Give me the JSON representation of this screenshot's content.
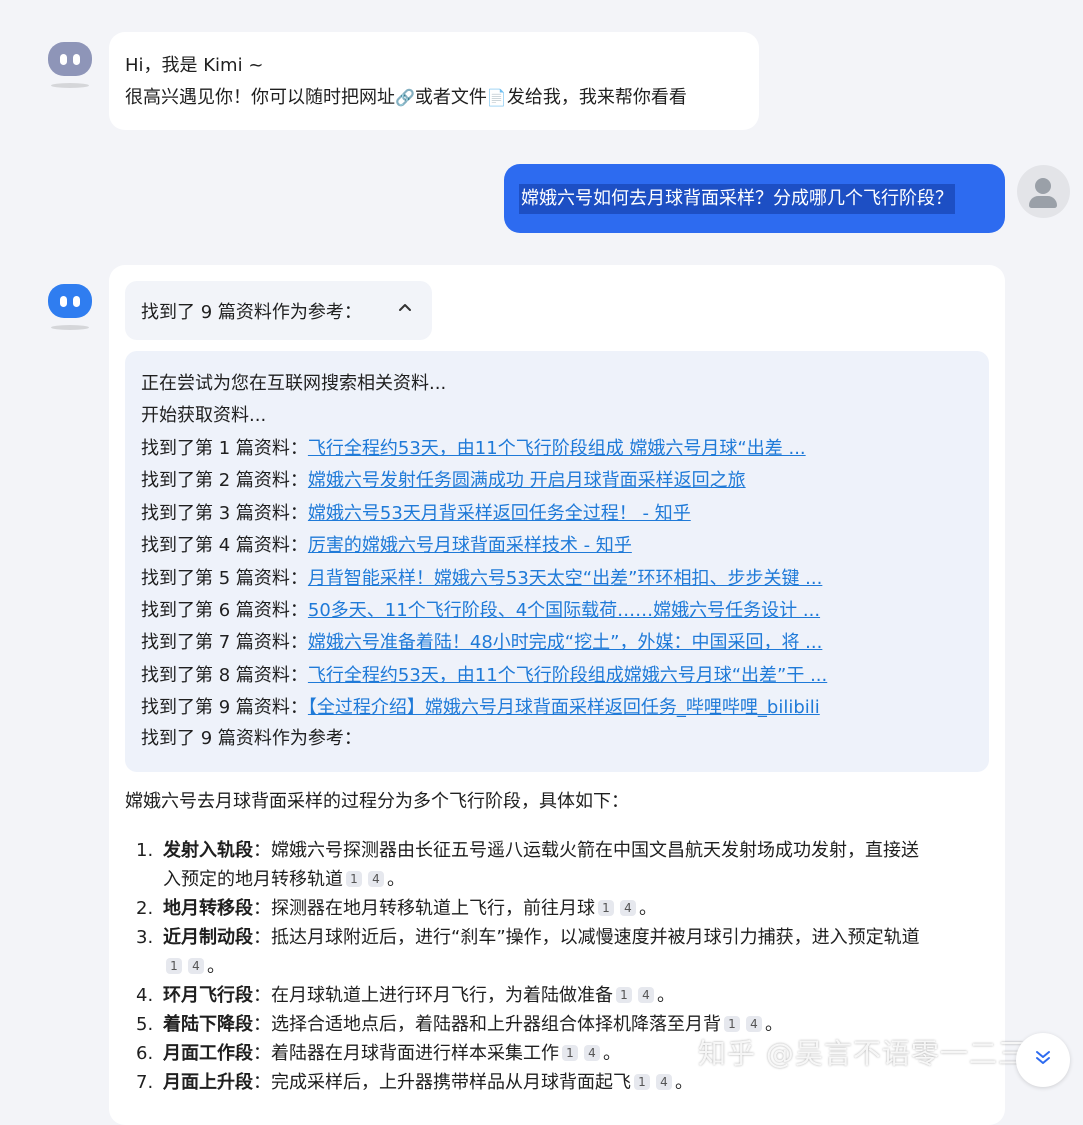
{
  "greeting": {
    "line1": "Hi，我是 Kimi ~",
    "line2_a": "很高兴遇见你！你可以随时把网址",
    "line2_link_icon": "🔗",
    "line2_b": "或者文件",
    "line2_file_icon": "📄",
    "line2_c": "发给我，我来帮你看看"
  },
  "user_message": "嫦娥六号如何去月球背面采样？分成哪几个飞行阶段？",
  "found_header": {
    "label": "找到了 9 篇资料作为参考：",
    "chevron": "⌃"
  },
  "search_log": {
    "trying": "正在尝试为您在互联网搜索相关资料...",
    "start": "开始获取资料...",
    "results": [
      {
        "prefix": "找到了第 1 篇资料：",
        "title": "飞行全程约53天，由11个飞行阶段组成 嫦娥六号月球“出差 ..."
      },
      {
        "prefix": "找到了第 2 篇资料：",
        "title": "嫦娥六号发射任务圆满成功 开启月球背面采样返回之旅"
      },
      {
        "prefix": "找到了第 3 篇资料：",
        "title": "嫦娥六号53天月背采样返回任务全过程！ - 知乎"
      },
      {
        "prefix": "找到了第 4 篇资料：",
        "title": "厉害的嫦娥六号月球背面采样技术 - 知乎"
      },
      {
        "prefix": "找到了第 5 篇资料：",
        "title": "月背智能采样！嫦娥六号53天太空“出差”环环相扣、步步关键 ..."
      },
      {
        "prefix": "找到了第 6 篇资料：",
        "title": "50多天、11个飞行阶段、4个国际载荷……嫦娥六号任务设计 ..."
      },
      {
        "prefix": "找到了第 7 篇资料：",
        "title": "嫦娥六号准备着陆！48小时完成“挖土”，外媒：中国采回，将 ..."
      },
      {
        "prefix": "找到了第 8 篇资料：",
        "title": "飞行全程约53天，由11个飞行阶段组成嫦娥六号月球“出差”干 ..."
      },
      {
        "prefix": "找到了第 9 篇资料：",
        "title": "【全过程介绍】嫦娥六号月球背面采样返回任务_哔哩哔哩_bilibili"
      }
    ],
    "footer": "找到了 9 篇资料作为参考："
  },
  "answer": {
    "intro": "嫦娥六号去月球背面采样的过程分为多个飞行阶段，具体如下：",
    "steps": [
      {
        "num": "1.",
        "name": "发射入轨段",
        "sep": "：",
        "text": "嫦娥六号探测器由长征五号遥八运载火箭在中国文昌航天发射场成功发射，直接送",
        "text2": "入预定的地月转移轨道",
        "cites": [
          "1",
          "4"
        ],
        "end": "。"
      },
      {
        "num": "2.",
        "name": "地月转移段",
        "sep": "：",
        "text": "探测器在地月转移轨道上飞行，前往月球",
        "cites": [
          "1",
          "4"
        ],
        "end": "。"
      },
      {
        "num": "3.",
        "name": "近月制动段",
        "sep": "：",
        "text": "抵达月球附近后，进行“刹车”操作，以减慢速度并被月球引力捕获，进入预定轨道",
        "cites": [
          "1",
          "4"
        ],
        "end": "。"
      },
      {
        "num": "4.",
        "name": "环月飞行段",
        "sep": "：",
        "text": "在月球轨道上进行环月飞行，为着陆做准备",
        "cites": [
          "1",
          "4"
        ],
        "end": "。"
      },
      {
        "num": "5.",
        "name": "着陆下降段",
        "sep": "：",
        "text": "选择合适地点后，着陆器和上升器组合体择机降落至月背",
        "cites": [
          "1",
          "4"
        ],
        "end": "。"
      },
      {
        "num": "6.",
        "name": "月面工作段",
        "sep": "：",
        "text": "着陆器在月球背面进行样本采集工作",
        "cites": [
          "1",
          "4"
        ],
        "end": "。"
      },
      {
        "num": "7.",
        "name": "月面上升段",
        "sep": "：",
        "text": "完成采样后，上升器携带样品从月球背面起飞",
        "cites": [
          "1",
          "4"
        ],
        "end": "。"
      }
    ]
  },
  "watermark": "知乎 @吴言不语零一二三",
  "scroll_icon": "double-chevron-down-icon",
  "colors": {
    "bot_avatar_gray": "#8e95b8",
    "bot_avatar_blue": "#2f7df0",
    "user_bubble": "#2d6bf0",
    "link": "#1f7ad8"
  }
}
